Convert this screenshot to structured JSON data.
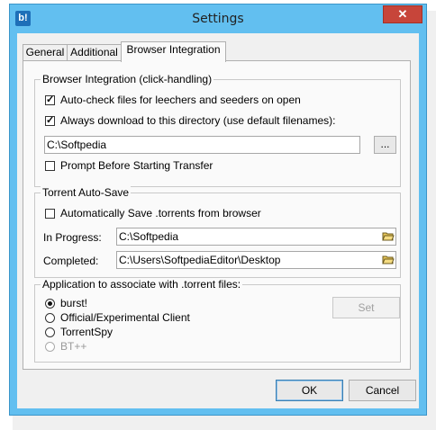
{
  "window": {
    "title": "Settings",
    "close_glyph": "✕",
    "app_icon_glyph": "b!"
  },
  "tabs": [
    {
      "label": "General",
      "active": false
    },
    {
      "label": "Additional",
      "active": false
    },
    {
      "label": "Browser Integration",
      "active": true
    }
  ],
  "browser_integration": {
    "title": "Browser Integration (click-handling)",
    "auto_check_label": "Auto-check files for leechers and seeders on open",
    "auto_check_checked": true,
    "always_download_label": "Always download to this directory (use default filenames):",
    "always_download_checked": true,
    "directory_value": "C:\\Softpedia",
    "browse_label": "...",
    "prompt_label": "Prompt Before Starting Transfer",
    "prompt_checked": false
  },
  "torrent_auto_save": {
    "title": "Torrent Auto-Save",
    "auto_save_label": "Automatically Save .torrents from browser",
    "auto_save_checked": false,
    "in_progress_label": "In Progress:",
    "in_progress_value": "C:\\Softpedia",
    "completed_label": "Completed:",
    "completed_value": "C:\\Users\\SoftpediaEditor\\Desktop"
  },
  "association": {
    "title": "Application to associate with .torrent files:",
    "options": [
      {
        "label": "burst!",
        "checked": true,
        "disabled": false
      },
      {
        "label": "Official/Experimental Client",
        "checked": false,
        "disabled": false
      },
      {
        "label": "TorrentSpy",
        "checked": false,
        "disabled": false
      },
      {
        "label": "BT++",
        "checked": false,
        "disabled": true
      }
    ],
    "set_label": "Set"
  },
  "footer": {
    "ok_label": "OK",
    "cancel_label": "Cancel"
  },
  "colors": {
    "title_bar": "#62bff0",
    "close_button": "#c7453a",
    "dialog_bg": "#f0f0f0"
  }
}
